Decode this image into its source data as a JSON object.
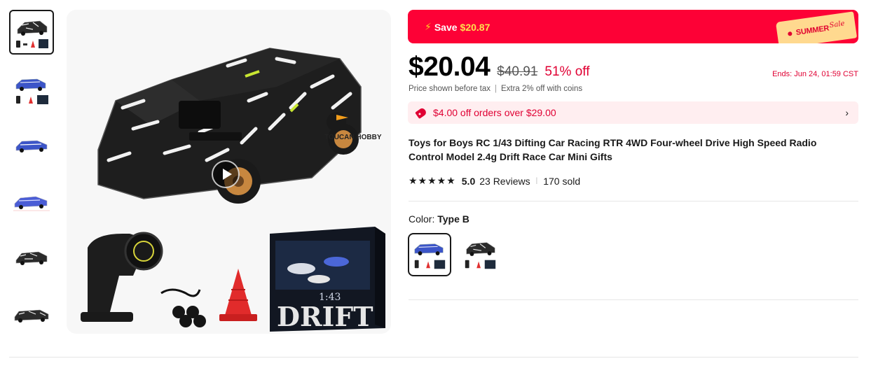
{
  "promo": {
    "save_label": "Save",
    "save_amount": "$20.87",
    "badge_main": "SUMMER",
    "badge_script": "Sale"
  },
  "price": {
    "current": "$20.04",
    "original": "$40.91",
    "discount": "51% off",
    "ends": "Ends: Jun 24, 01:59 CST",
    "tax_note": "Price shown before tax",
    "coins_note": "Extra 2% off with coins"
  },
  "coupon": {
    "text": "$4.00 off orders over $29.00"
  },
  "product": {
    "title": "Toys for Boys RC 1/43 Difting Car Racing RTR 4WD Four-wheel Drive High Speed Radio Control Model 2.4g Drift Race Car Mini Gifts",
    "rating": "5.0",
    "rating_value": 5,
    "reviews": "23 Reviews",
    "sold": "170 sold"
  },
  "variant": {
    "label": "Color:",
    "selected": "Type B"
  },
  "main_image": {
    "watermark": "TOUCAN HOBBY",
    "box_text": "DRIFT",
    "box_scale": "1:43"
  },
  "colors": {
    "accent": "#fd0136",
    "discount_red": "#e00033",
    "coupon_bg": "#ffeef0",
    "badge_yellow": "#ffd98f"
  }
}
